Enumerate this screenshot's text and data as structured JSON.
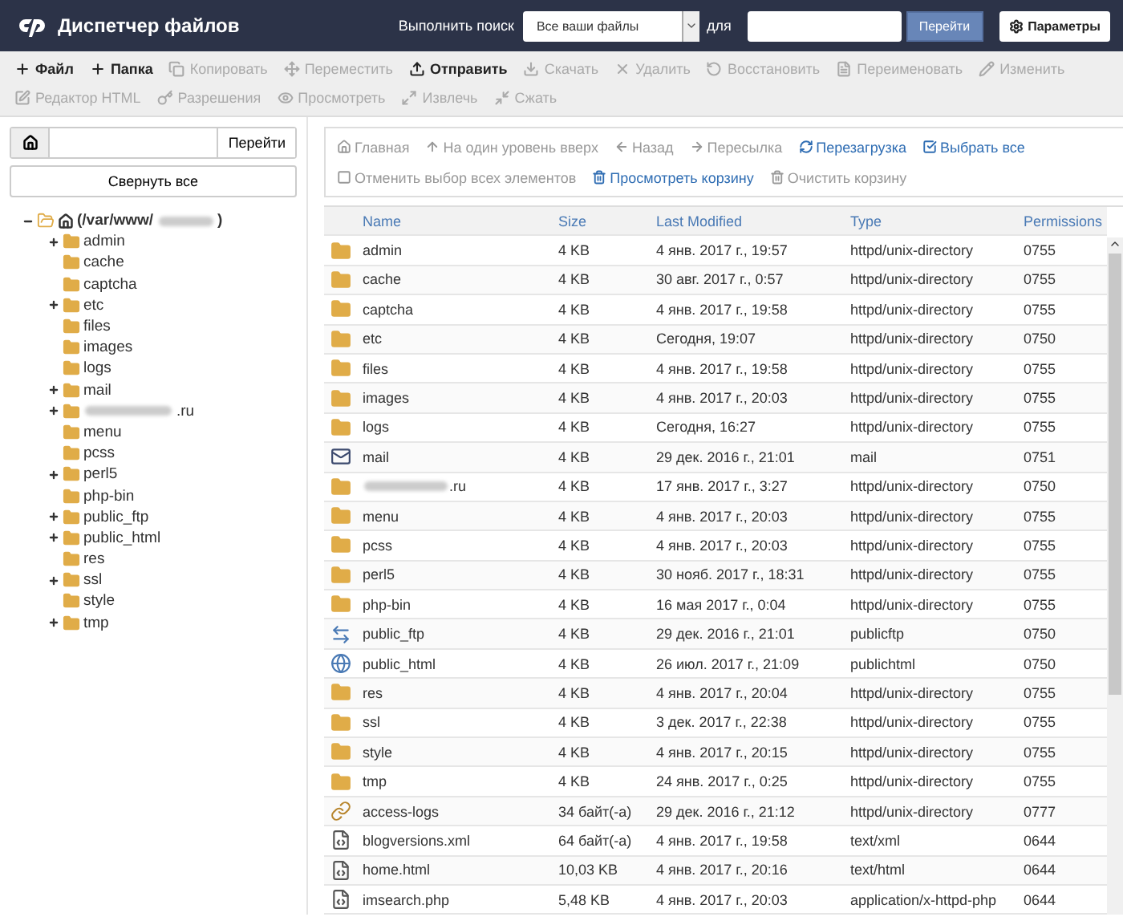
{
  "header": {
    "title": "Диспетчер файлов",
    "search_label": "Выполнить поиск",
    "scope": "Все ваши файлы",
    "for_label": "для",
    "go": "Перейти",
    "settings": "Параметры"
  },
  "toolbar": [
    [
      {
        "label": "Файл",
        "kind": "plus",
        "disabled": false
      },
      {
        "label": "Папка",
        "kind": "plus",
        "disabled": false
      },
      {
        "label": "Копировать",
        "kind": "copy",
        "disabled": true
      },
      {
        "label": "Переместить",
        "kind": "move",
        "disabled": true
      },
      {
        "label": "Отправить",
        "kind": "upload",
        "disabled": false
      },
      {
        "label": "Скачать",
        "kind": "download",
        "disabled": true
      },
      {
        "label": "Удалить",
        "kind": "x",
        "disabled": true
      },
      {
        "label": "Восстановить",
        "kind": "undo",
        "disabled": true
      },
      {
        "label": "Переименовать",
        "kind": "file",
        "disabled": true
      },
      {
        "label": "Изменить",
        "kind": "pencil",
        "disabled": true
      }
    ],
    [
      {
        "label": "Редактор HTML",
        "kind": "edit",
        "disabled": true
      },
      {
        "label": "Разрешения",
        "kind": "key",
        "disabled": true
      },
      {
        "label": "Просмотреть",
        "kind": "eye",
        "disabled": true
      },
      {
        "label": "Извлечь",
        "kind": "expand",
        "disabled": true
      },
      {
        "label": "Сжать",
        "kind": "shrink",
        "disabled": true
      }
    ]
  ],
  "sidebar": {
    "go": "Перейти",
    "collapse": "Свернуть все",
    "root": {
      "prefix": "(/var/www/",
      "suffix": ")",
      "expanded": true,
      "children": [
        {
          "name": "admin",
          "kind": "branch"
        },
        {
          "name": "cache",
          "kind": "leaf"
        },
        {
          "name": "captcha",
          "kind": "leaf"
        },
        {
          "name": "etc",
          "kind": "branch"
        },
        {
          "name": "files",
          "kind": "leaf"
        },
        {
          "name": "images",
          "kind": "leaf"
        },
        {
          "name": "logs",
          "kind": "leaf"
        },
        {
          "name": "mail",
          "kind": "branch"
        },
        {
          "name": ".ru",
          "kind": "branch",
          "redacted": true
        },
        {
          "name": "menu",
          "kind": "leaf"
        },
        {
          "name": "pcss",
          "kind": "leaf"
        },
        {
          "name": "perl5",
          "kind": "branch"
        },
        {
          "name": "php-bin",
          "kind": "leaf"
        },
        {
          "name": "public_ftp",
          "kind": "branch"
        },
        {
          "name": "public_html",
          "kind": "branch"
        },
        {
          "name": "res",
          "kind": "leaf"
        },
        {
          "name": "ssl",
          "kind": "branch"
        },
        {
          "name": "style",
          "kind": "leaf"
        },
        {
          "name": "tmp",
          "kind": "branch"
        }
      ]
    }
  },
  "nav": [
    [
      {
        "label": "Главная",
        "kind": "home",
        "disabled": true
      },
      {
        "label": "На один уровень вверх",
        "kind": "up",
        "disabled": true
      },
      {
        "label": "Назад",
        "kind": "left",
        "disabled": true
      },
      {
        "label": "Пересылка",
        "kind": "right",
        "disabled": true
      },
      {
        "label": "Перезагрузка",
        "kind": "reload",
        "disabled": false
      },
      {
        "label": "Выбрать все",
        "kind": "check",
        "disabled": false
      }
    ],
    [
      {
        "label": "Отменить выбор всех элементов",
        "kind": "box",
        "disabled": true
      },
      {
        "label": "Просмотреть корзину",
        "kind": "trash",
        "disabled": false
      },
      {
        "label": "Очистить корзину",
        "kind": "trash",
        "disabled": true
      }
    ]
  ],
  "table": {
    "columns": [
      "Name",
      "Size",
      "Last Modified",
      "Type",
      "Permissions"
    ],
    "rows": [
      {
        "kind": "folder",
        "name": "admin",
        "size": "4 KB",
        "modified": "4 янв. 2017 г., 19:57",
        "type": "httpd/unix-directory",
        "perm": "0755"
      },
      {
        "kind": "folder",
        "name": "cache",
        "size": "4 KB",
        "modified": "30 авг. 2017 г., 0:57",
        "type": "httpd/unix-directory",
        "perm": "0755"
      },
      {
        "kind": "folder",
        "name": "captcha",
        "size": "4 KB",
        "modified": "4 янв. 2017 г., 19:58",
        "type": "httpd/unix-directory",
        "perm": "0755"
      },
      {
        "kind": "folder",
        "name": "etc",
        "size": "4 KB",
        "modified": "Сегодня, 19:07",
        "type": "httpd/unix-directory",
        "perm": "0750"
      },
      {
        "kind": "folder",
        "name": "files",
        "size": "4 KB",
        "modified": "4 янв. 2017 г., 19:58",
        "type": "httpd/unix-directory",
        "perm": "0755"
      },
      {
        "kind": "folder",
        "name": "images",
        "size": "4 KB",
        "modified": "4 янв. 2017 г., 20:03",
        "type": "httpd/unix-directory",
        "perm": "0755"
      },
      {
        "kind": "folder",
        "name": "logs",
        "size": "4 KB",
        "modified": "Сегодня, 16:27",
        "type": "httpd/unix-directory",
        "perm": "0755"
      },
      {
        "kind": "mail",
        "name": "mail",
        "size": "4 KB",
        "modified": "29 дек. 2016 г., 21:01",
        "type": "mail",
        "perm": "0751"
      },
      {
        "kind": "folder",
        "name": ".ru",
        "redacted": true,
        "size": "4 KB",
        "modified": "17 янв. 2017 г., 3:27",
        "type": "httpd/unix-directory",
        "perm": "0750"
      },
      {
        "kind": "folder",
        "name": "menu",
        "size": "4 KB",
        "modified": "4 янв. 2017 г., 20:03",
        "type": "httpd/unix-directory",
        "perm": "0755"
      },
      {
        "kind": "folder",
        "name": "pcss",
        "size": "4 KB",
        "modified": "4 янв. 2017 г., 20:03",
        "type": "httpd/unix-directory",
        "perm": "0755"
      },
      {
        "kind": "folder",
        "name": "perl5",
        "size": "4 KB",
        "modified": "30 нояб. 2017 г., 18:31",
        "type": "httpd/unix-directory",
        "perm": "0755"
      },
      {
        "kind": "folder",
        "name": "php-bin",
        "size": "4 KB",
        "modified": "16 мая 2017 г., 0:04",
        "type": "httpd/unix-directory",
        "perm": "0755"
      },
      {
        "kind": "ftp",
        "name": "public_ftp",
        "size": "4 KB",
        "modified": "29 дек. 2016 г., 21:01",
        "type": "publicftp",
        "perm": "0750"
      },
      {
        "kind": "web",
        "name": "public_html",
        "size": "4 KB",
        "modified": "26 июл. 2017 г., 21:09",
        "type": "publichtml",
        "perm": "0750"
      },
      {
        "kind": "folder",
        "name": "res",
        "size": "4 KB",
        "modified": "4 янв. 2017 г., 20:04",
        "type": "httpd/unix-directory",
        "perm": "0755"
      },
      {
        "kind": "folder",
        "name": "ssl",
        "size": "4 KB",
        "modified": "3 дек. 2017 г., 22:38",
        "type": "httpd/unix-directory",
        "perm": "0755"
      },
      {
        "kind": "folder",
        "name": "style",
        "size": "4 KB",
        "modified": "4 янв. 2017 г., 20:15",
        "type": "httpd/unix-directory",
        "perm": "0755"
      },
      {
        "kind": "folder",
        "name": "tmp",
        "size": "4 KB",
        "modified": "24 янв. 2017 г., 0:25",
        "type": "httpd/unix-directory",
        "perm": "0755"
      },
      {
        "kind": "link",
        "name": "access-logs",
        "size": "34 байт(-а)",
        "modified": "29 дек. 2016 г., 21:12",
        "type": "httpd/unix-directory",
        "perm": "0777"
      },
      {
        "kind": "file",
        "name": "blogversions.xml",
        "size": "64 байт(-а)",
        "modified": "4 янв. 2017 г., 19:58",
        "type": "text/xml",
        "perm": "0644"
      },
      {
        "kind": "file",
        "name": "home.html",
        "size": "10,03 KB",
        "modified": "4 янв. 2017 г., 20:16",
        "type": "text/html",
        "perm": "0644"
      },
      {
        "kind": "file",
        "name": "imsearch.php",
        "size": "5,48 KB",
        "modified": "4 янв. 2017 г., 20:03",
        "type": "application/x-httpd-php",
        "perm": "0644"
      }
    ]
  }
}
